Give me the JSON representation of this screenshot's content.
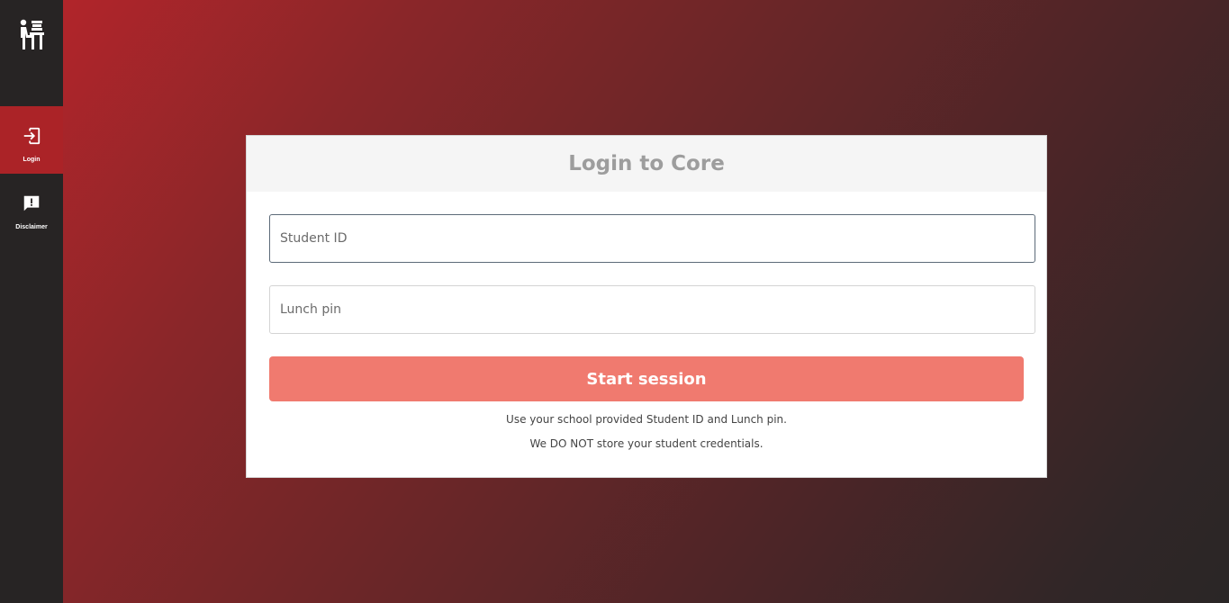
{
  "sidebar": {
    "logo_icon": "student-desk-logo-icon",
    "items": [
      {
        "label": "Login",
        "icon": "login-arrow-icon",
        "active": true
      },
      {
        "label": "Disclaimer",
        "icon": "alert-chat-icon",
        "active": false
      }
    ]
  },
  "login": {
    "title": "Login to Core",
    "student_id": {
      "placeholder": "Student ID",
      "value": ""
    },
    "lunch_pin": {
      "placeholder": "Lunch pin",
      "value": ""
    },
    "submit_label": "Start session",
    "notes": [
      "Use your school provided Student ID and Lunch pin.",
      "We DO NOT store your student credentials."
    ]
  },
  "colors": {
    "sidebar_bg": "#272424",
    "active_nav": "#ab2327",
    "button": "#f07a6f",
    "gradient_start": "#b1252a",
    "gradient_end": "#2a2626"
  }
}
